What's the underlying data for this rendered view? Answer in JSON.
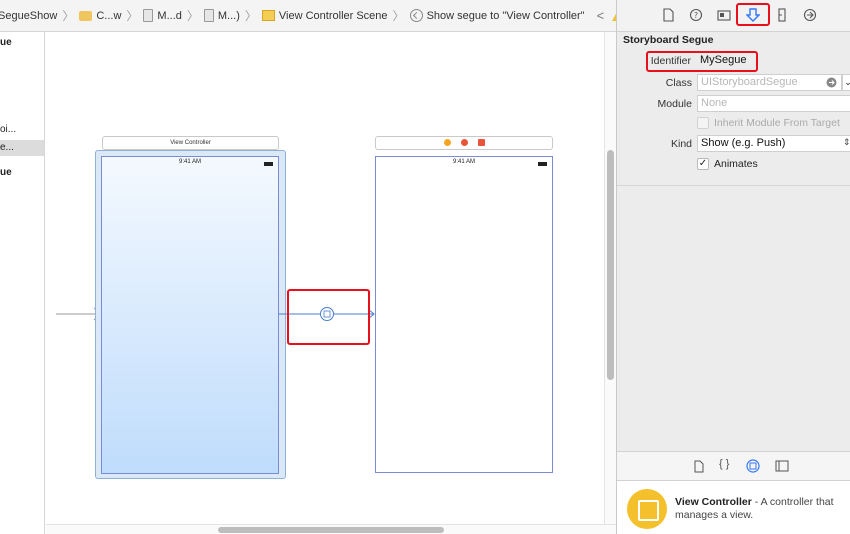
{
  "jumpbar": {
    "crumbs": [
      {
        "label": "SegueShow",
        "icon": "project-icon"
      },
      {
        "label": "C...w",
        "icon": "folder-icon"
      },
      {
        "label": "M...d",
        "icon": "file-icon"
      },
      {
        "label": "M...)",
        "icon": "file-icon"
      },
      {
        "label": "View Controller Scene",
        "icon": "scene-icon"
      },
      {
        "label": "Show segue to \"View Controller\"",
        "icon": "segue-icon"
      }
    ],
    "back_glyph": "<",
    "forward_glyph": ">",
    "warning_icon": "warning-icon"
  },
  "outline": {
    "items": [
      "ue",
      "oi...",
      "e...",
      "ue"
    ]
  },
  "canvas": {
    "source_scene_title": "View Controller",
    "source_status_time": "9:41 AM",
    "dest_status_time": "9:41 AM",
    "dest_dock_colors": [
      "#f5a623",
      "#e8553a",
      "#e8553a"
    ]
  },
  "inspector": {
    "tabs": [
      "file-inspector-icon",
      "quick-help-icon",
      "identity-icon",
      "attributes-icon",
      "size-icon",
      "connections-icon"
    ],
    "section_title": "Storyboard Segue",
    "identifier_label": "Identifier",
    "identifier_value": "MySegue",
    "class_label": "Class",
    "class_placeholder": "UIStoryboardSegue",
    "module_label": "Module",
    "module_placeholder": "None",
    "inherit_label": "Inherit Module From Target",
    "kind_label": "Kind",
    "kind_value": "Show (e.g. Push)",
    "animates_label": "Animates",
    "animates_checked": true,
    "check_glyph": "✓"
  },
  "library": {
    "tabs": [
      "file-template-icon",
      "code-snippet-icon",
      "object-library-icon",
      "media-library-icon"
    ],
    "item_title": "View Controller",
    "item_desc_line1": "- A controller that",
    "item_desc_line2": "manages a view."
  },
  "colors": {
    "highlight": "#e8101c",
    "accent": "#3478f6"
  }
}
